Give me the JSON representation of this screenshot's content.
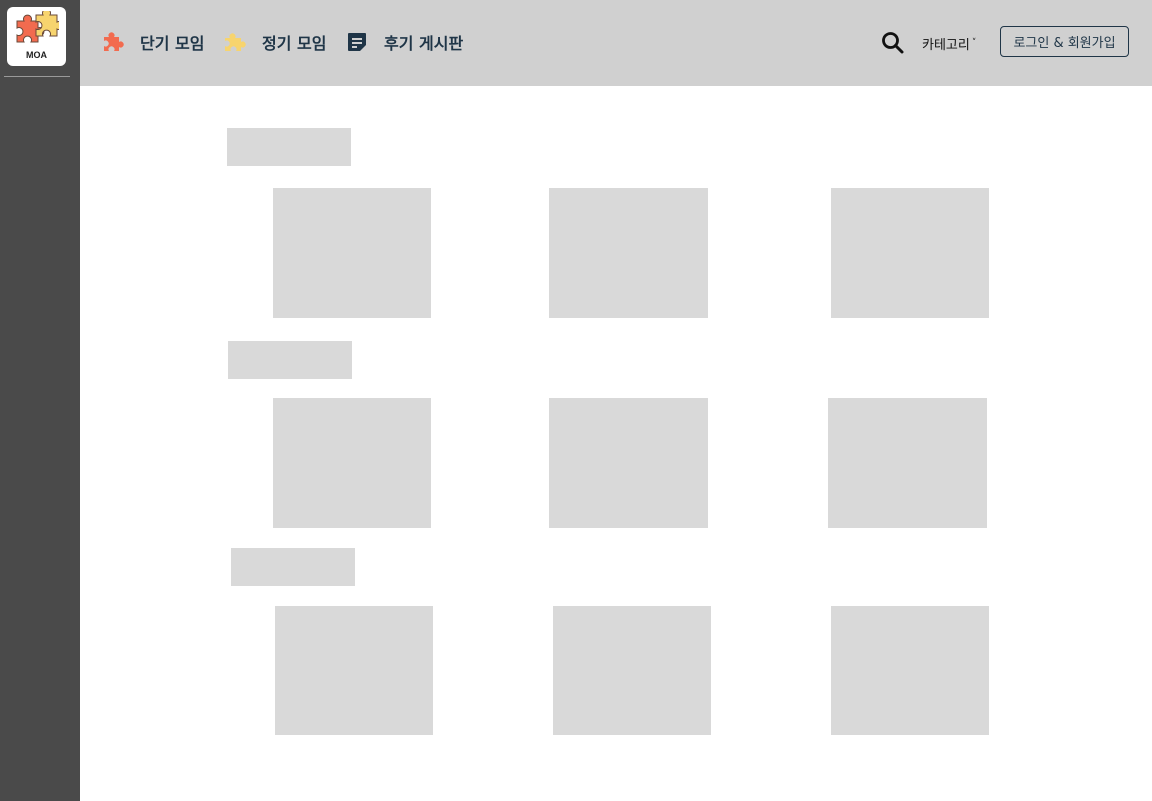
{
  "brand": {
    "logo_text": "MOA",
    "colors": {
      "piece_orange": "#f26b4f",
      "piece_yellow": "#f7d46e",
      "nav_text": "#1f3547",
      "sidebar_bg": "#4a4a4a",
      "header_bg": "#d0d0d0",
      "placeholder": "#d9d9d9"
    }
  },
  "nav": {
    "items": [
      {
        "label": "단기 모임",
        "icon": "puzzle-orange-icon"
      },
      {
        "label": "정기 모임",
        "icon": "puzzle-yellow-icon"
      },
      {
        "label": "후기 게시판",
        "icon": "note-icon"
      }
    ]
  },
  "header": {
    "search_icon": "search-icon",
    "category_label": "카테고리",
    "category_chevron": "˅",
    "login_label": "로그인 & 회원가입"
  },
  "sections": [
    {
      "name": "section-1",
      "card_count": 3
    },
    {
      "name": "section-2",
      "card_count": 3
    },
    {
      "name": "section-3",
      "card_count": 3
    }
  ]
}
